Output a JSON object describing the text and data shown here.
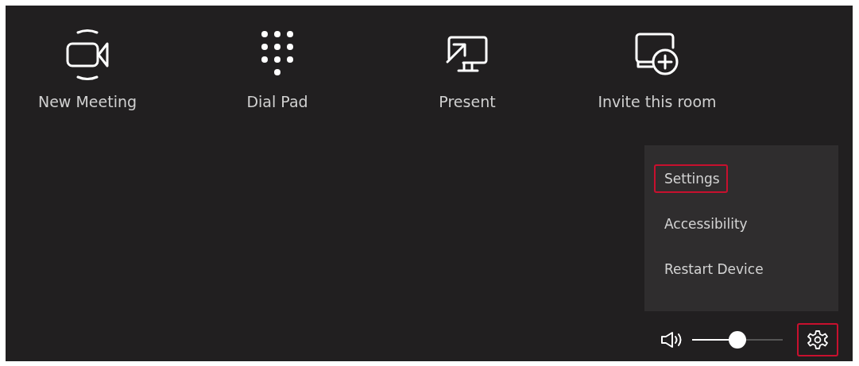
{
  "actions": [
    {
      "kind": "meeting",
      "label": "New Meeting"
    },
    {
      "kind": "dialpad",
      "label": "Dial Pad"
    },
    {
      "kind": "present",
      "label": "Present"
    },
    {
      "kind": "invite",
      "label": "Invite this room"
    }
  ],
  "menu": {
    "items": [
      {
        "label": "Settings",
        "highlighted": true
      },
      {
        "label": "Accessibility",
        "highlighted": false
      },
      {
        "label": "Restart Device",
        "highlighted": false
      }
    ]
  },
  "volume": {
    "level": 0.5
  },
  "settings_button": {
    "highlighted": true
  }
}
